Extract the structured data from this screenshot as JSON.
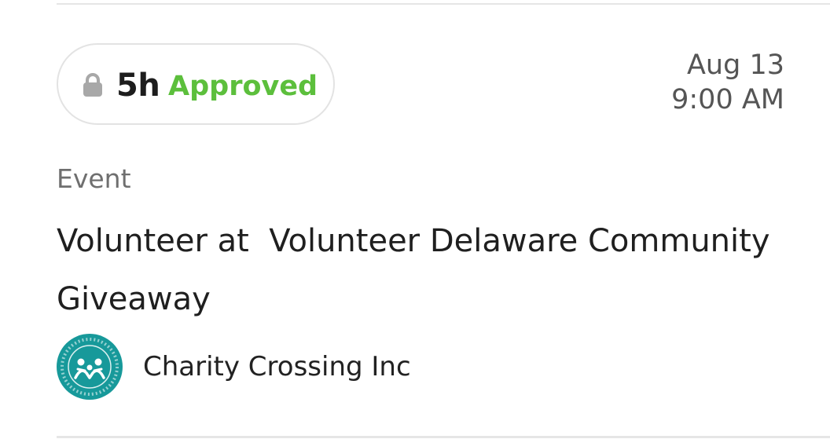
{
  "card": {
    "duration": "5h",
    "status": "Approved",
    "date": "Aug 13",
    "time": "9:00 AM",
    "category": "Event",
    "title": "Volunteer at  Volunteer Delaware Community Giveaway",
    "organization": "Charity Crossing Inc",
    "icons": {
      "lock": "lock-icon",
      "logo": "charity-crossing-logo"
    },
    "colors": {
      "status": "#5cbf3c",
      "logo": "#17999a"
    }
  }
}
